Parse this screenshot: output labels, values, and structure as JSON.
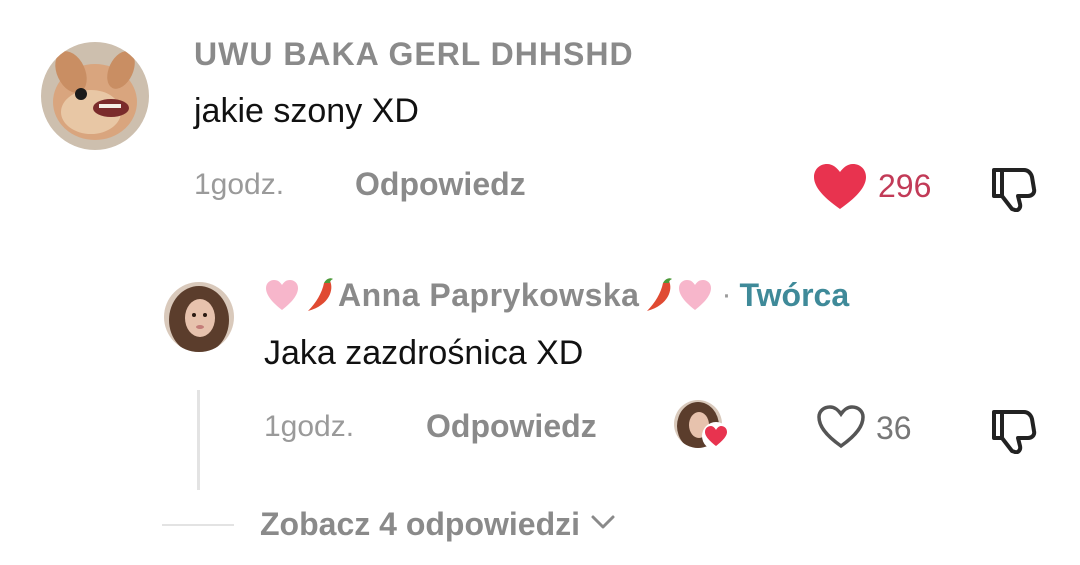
{
  "comment": {
    "username": "UWU BAKA GERL DHHSHD",
    "text": "jakie szony XD",
    "time": "1godz.",
    "reply_label": "Odpowiedz",
    "likes": "296",
    "liked": true
  },
  "reply": {
    "username": "Anna Paprykowska",
    "creator_label": "Twórca",
    "dot": "·",
    "text": "Jaka zazdrośnica XD",
    "time": "1godz.",
    "reply_label": "Odpowiedz",
    "likes": "36",
    "liked": false
  },
  "view_more_label": "Zobacz 4 odpowiedzi",
  "colors": {
    "like_red": "#e8334f",
    "creator_teal": "#3f8a99",
    "muted": "#8a8a8a"
  }
}
